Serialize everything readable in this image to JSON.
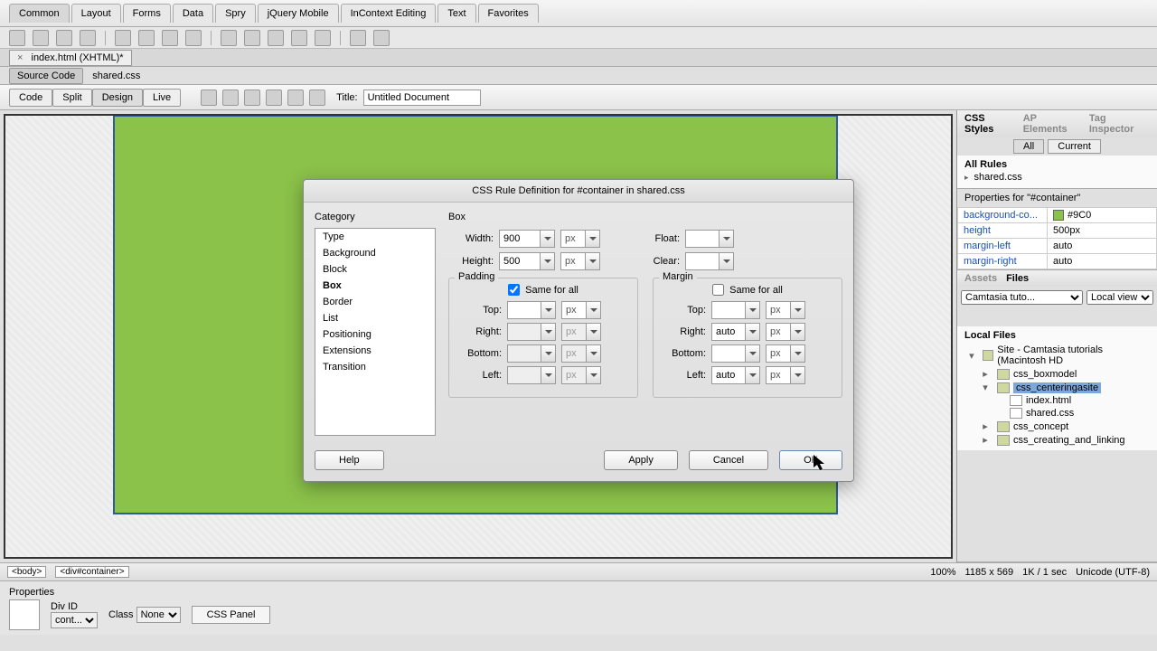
{
  "topbar": {
    "tabs": [
      "Common",
      "Layout",
      "Forms",
      "Data",
      "Spry",
      "jQuery Mobile",
      "InContext Editing",
      "Text",
      "Favorites"
    ],
    "active": 0
  },
  "file_tab": {
    "label": "index.html (XHTML)*"
  },
  "source_bar": {
    "source_code": "Source Code",
    "files": [
      "shared.css"
    ]
  },
  "view_bar": {
    "buttons": [
      "Code",
      "Split",
      "Design",
      "Live"
    ],
    "active": 2,
    "title_label": "Title:",
    "title_value": "Untitled Document"
  },
  "css_panel": {
    "tabs": [
      "CSS Styles",
      "AP Elements",
      "Tag Inspector"
    ],
    "modes": [
      "All",
      "Current"
    ],
    "mode_active": 0,
    "rules_label": "All Rules",
    "rules": [
      "shared.css"
    ],
    "props_label": "Properties for \"#container\"",
    "props": [
      {
        "name": "background-co...",
        "value": "#9C0",
        "swatch": true
      },
      {
        "name": "height",
        "value": "500px"
      },
      {
        "name": "margin-left",
        "value": "auto"
      },
      {
        "name": "margin-right",
        "value": "auto"
      }
    ]
  },
  "files_panel": {
    "tabs": [
      "Assets",
      "Files"
    ],
    "active": 1,
    "site_select": "Camtasia tuto...",
    "view_select": "Local view",
    "label": "Local Files",
    "tree": [
      {
        "lv": 0,
        "open": true,
        "name": "Site - Camtasia tutorials (Macintosh HD"
      },
      {
        "lv": 1,
        "open": false,
        "name": "css_boxmodel"
      },
      {
        "lv": 1,
        "open": true,
        "name": "css_centeringasite",
        "sel": true
      },
      {
        "lv": 2,
        "file": true,
        "name": "index.html"
      },
      {
        "lv": 2,
        "file": true,
        "name": "shared.css"
      },
      {
        "lv": 1,
        "open": false,
        "name": "css_concept"
      },
      {
        "lv": 1,
        "open": false,
        "name": "css_creating_and_linking"
      }
    ]
  },
  "status": {
    "tags": [
      "<body>",
      "<div#container>"
    ],
    "zoom": "100%",
    "dims": "1185 x 569",
    "perf": "1K / 1 sec",
    "encoding": "Unicode (UTF-8)"
  },
  "prop_inspector": {
    "title": "Properties",
    "div_id_label": "Div ID",
    "div_id_value": "cont...",
    "class_label": "Class",
    "class_value": "None",
    "css_panel_btn": "CSS Panel"
  },
  "dialog": {
    "title": "CSS Rule Definition for #container in shared.css",
    "category_label": "Category",
    "categories": [
      "Type",
      "Background",
      "Block",
      "Box",
      "Border",
      "List",
      "Positioning",
      "Extensions",
      "Transition"
    ],
    "active_category": "Box",
    "section_title": "Box",
    "width_label": "Width:",
    "width_value": "900",
    "width_unit": "px",
    "height_label": "Height:",
    "height_value": "500",
    "height_unit": "px",
    "float_label": "Float:",
    "float_value": "",
    "clear_label": "Clear:",
    "clear_value": "",
    "padding_label": "Padding",
    "margin_label": "Margin",
    "same_label": "Same for all",
    "padding_same": true,
    "margin_same": false,
    "sides": [
      "Top:",
      "Right:",
      "Bottom:",
      "Left:"
    ],
    "padding_values": [
      "",
      "",
      "",
      ""
    ],
    "padding_units": [
      "px",
      "px",
      "px",
      "px"
    ],
    "margin_values": [
      "",
      "auto",
      "",
      "auto"
    ],
    "margin_units": [
      "px",
      "px",
      "px",
      "px"
    ],
    "buttons": {
      "help": "Help",
      "apply": "Apply",
      "cancel": "Cancel",
      "ok": "OK"
    }
  }
}
